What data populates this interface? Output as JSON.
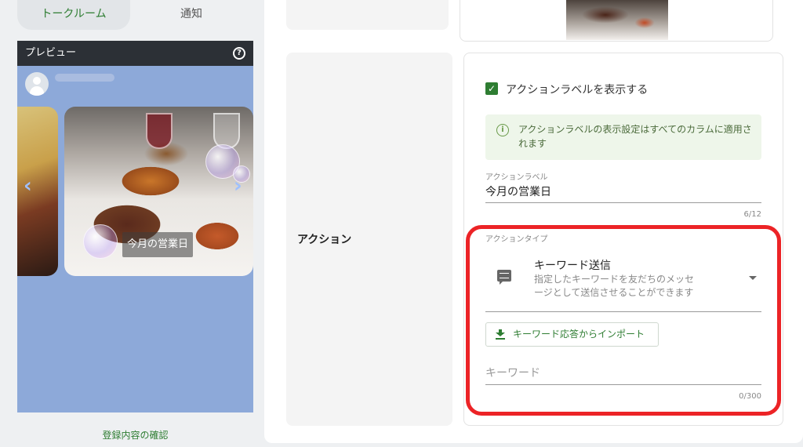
{
  "tabs": [
    {
      "label": "トークルーム",
      "active": true
    },
    {
      "label": "通知",
      "active": false
    }
  ],
  "preview": {
    "header_title": "プレビュー",
    "help_icon": "question-circle-icon",
    "card_label": "今月の営業日",
    "background_color": "#8da9d9"
  },
  "confirm_link": "登録内容の確認",
  "action": {
    "row_label": "アクション",
    "show_label_checkbox": {
      "label": "アクションラベルを表示する",
      "checked": true
    },
    "info_text": "アクションラベルの表示設定はすべてのカラムに適用されます",
    "label_field": {
      "caption": "アクションラベル",
      "value": "今月の営業日",
      "counter": "6/12"
    },
    "type_field": {
      "caption": "アクションタイプ",
      "selected_title": "キーワード送信",
      "selected_desc": "指定したキーワードを友だちのメッセージとして送信させることができます",
      "icon": "chat-message-icon"
    },
    "import_button": "キーワード応答からインポート",
    "keyword_field": {
      "placeholder": "キーワード",
      "value": "",
      "counter": "0/300"
    }
  },
  "colors": {
    "accent_green": "#2e7d32",
    "highlight_red": "#ec2326",
    "info_bg": "#eef6ea"
  }
}
